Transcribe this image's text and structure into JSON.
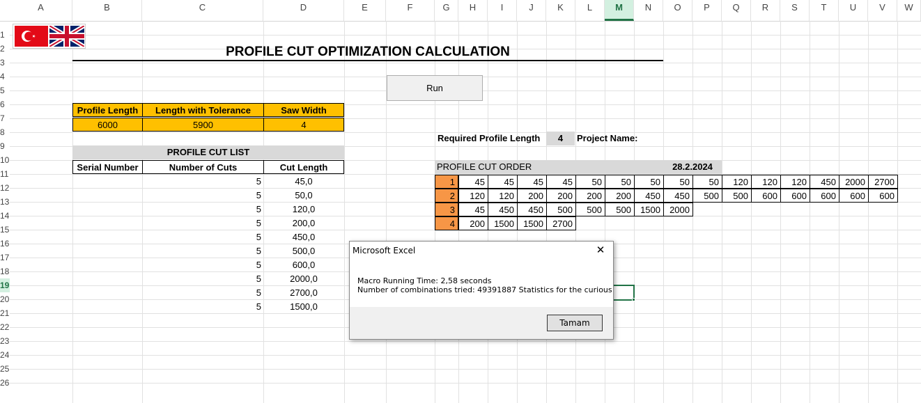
{
  "columns": [
    "A",
    "B",
    "C",
    "D",
    "E",
    "F",
    "G",
    "H",
    "I",
    "J",
    "K",
    "L",
    "M",
    "N",
    "O",
    "P",
    "Q",
    "R",
    "S",
    "T",
    "U",
    "V",
    "W"
  ],
  "selected_column": "M",
  "rows": [
    "1",
    "2",
    "3",
    "4",
    "5",
    "6",
    "7",
    "8",
    "9",
    "10",
    "11",
    "12",
    "13",
    "14",
    "15",
    "16",
    "17",
    "18",
    "19",
    "20",
    "21",
    "22",
    "23",
    "24",
    "25",
    "26"
  ],
  "selected_row": "19",
  "title": "PROFILE CUT OPTIMIZATION CALCULATION",
  "run_label": "Run",
  "params": {
    "headers": [
      "Profile Length",
      "Length with Tolerance",
      "Saw Width"
    ],
    "values": [
      "6000",
      "5900",
      "4"
    ]
  },
  "cut_list": {
    "title": "PROFILE CUT LIST",
    "headers": [
      "Serial Number",
      "Number of Cuts",
      "Cut Length"
    ],
    "rows": [
      {
        "count": "5",
        "length": "45,0"
      },
      {
        "count": "5",
        "length": "50,0"
      },
      {
        "count": "5",
        "length": "120,0"
      },
      {
        "count": "5",
        "length": "200,0"
      },
      {
        "count": "5",
        "length": "450,0"
      },
      {
        "count": "5",
        "length": "500,0"
      },
      {
        "count": "5",
        "length": "600,0"
      },
      {
        "count": "5",
        "length": "2000,0"
      },
      {
        "count": "5",
        "length": "2700,0"
      },
      {
        "count": "5",
        "length": "1500,0"
      }
    ]
  },
  "required": {
    "label": "Required Profile Length",
    "value": "4",
    "project_label": "Project Name:"
  },
  "order": {
    "title": "PROFILE CUT ORDER",
    "date": "28.2.2024",
    "rows": [
      {
        "n": "1",
        "cuts": [
          "45",
          "45",
          "45",
          "45",
          "50",
          "50",
          "50",
          "50",
          "50",
          "120",
          "120",
          "120",
          "450",
          "2000",
          "2700"
        ]
      },
      {
        "n": "2",
        "cuts": [
          "120",
          "120",
          "200",
          "200",
          "200",
          "200",
          "450",
          "450",
          "500",
          "500",
          "600",
          "600",
          "600",
          "600",
          "600"
        ]
      },
      {
        "n": "3",
        "cuts": [
          "45",
          "450",
          "450",
          "500",
          "500",
          "500",
          "1500",
          "2000"
        ]
      },
      {
        "n": "4",
        "cuts": [
          "200",
          "1500",
          "1500",
          "2700"
        ]
      }
    ]
  },
  "dialog": {
    "title": "Microsoft Excel",
    "line1": "Macro Running Time: 2,58 seconds",
    "line2": "Number of combinations tried: 49391887 Statistics for the curious",
    "ok_label": "Tamam",
    "close_glyph": "✕"
  }
}
